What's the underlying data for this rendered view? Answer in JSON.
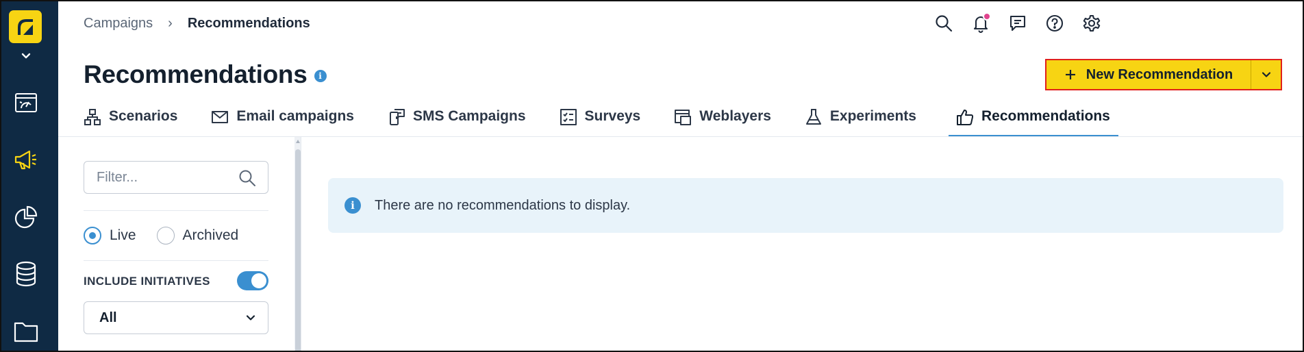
{
  "breadcrumb": {
    "parent": "Campaigns",
    "separator": "›",
    "current": "Recommendations"
  },
  "page": {
    "title": "Recommendations",
    "info_glyph": "i"
  },
  "actions": {
    "new_label": "New Recommendation"
  },
  "tabs": [
    {
      "label": "Scenarios",
      "icon": "scenarios-icon"
    },
    {
      "label": "Email campaigns",
      "icon": "email-icon"
    },
    {
      "label": "SMS Campaigns",
      "icon": "sms-icon"
    },
    {
      "label": "Surveys",
      "icon": "survey-icon"
    },
    {
      "label": "Weblayers",
      "icon": "weblayer-icon"
    },
    {
      "label": "Experiments",
      "icon": "flask-icon"
    },
    {
      "label": "Recommendations",
      "icon": "thumbs-up-icon",
      "active": true
    }
  ],
  "filter": {
    "placeholder": "Filter...",
    "status_options": [
      {
        "label": "Live",
        "selected": true
      },
      {
        "label": "Archived",
        "selected": false
      }
    ],
    "include_initiatives_label": "INCLUDE INITIATIVES",
    "include_initiatives_on": true,
    "initiative_select_value": "All"
  },
  "empty_state": {
    "message": "There are no recommendations to display.",
    "info_glyph": "i"
  },
  "rail_icons": [
    "dashboard-icon",
    "megaphone-icon",
    "analytics-pie-icon",
    "database-icon",
    "folder-icon"
  ],
  "top_icons": [
    "search-icon",
    "bell-icon",
    "chat-icon",
    "help-icon",
    "settings-icon"
  ],
  "colors": {
    "brand_yellow": "#f7d413",
    "rail_navy": "#0f2a44",
    "accent_blue": "#3a8fd0",
    "notif_pink": "#e0458f",
    "notice_bg": "#e8f3fa"
  }
}
